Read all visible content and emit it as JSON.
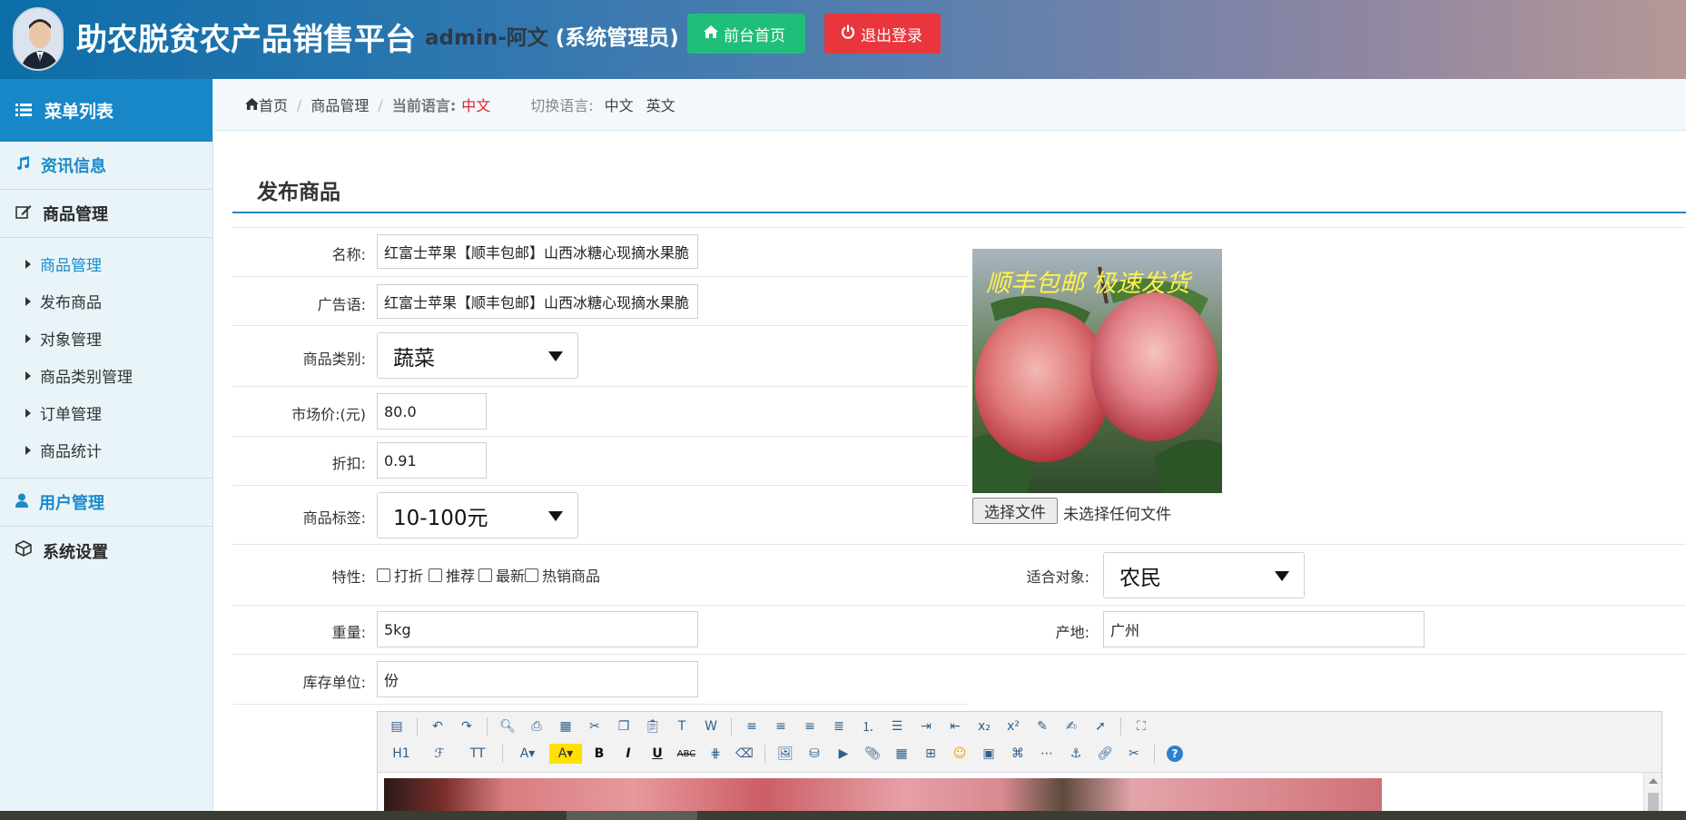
{
  "header": {
    "site_title": "助农脱贫农产品销售平台",
    "admin_user": "admin-阿文",
    "admin_role": "(系统管理员)",
    "home_button": "前台首页",
    "logout_button": "退出登录"
  },
  "sidebar": {
    "menu_title": "菜单列表",
    "sections": {
      "news": "资讯信息",
      "goods": "商品管理",
      "users": "用户管理",
      "settings": "系统设置"
    },
    "sub_items": [
      "商品管理",
      "发布商品",
      "对象管理",
      "商品类别管理",
      "订单管理",
      "商品统计"
    ]
  },
  "breadcrumb": {
    "home": "首页",
    "section": "商品管理",
    "current_lang_label": "当前语言:",
    "current_lang": "中文",
    "switch_label": "切换语言:",
    "lang_zh": "中文",
    "lang_en": "英文"
  },
  "page": {
    "heading": "发布商品"
  },
  "form": {
    "name_label": "名称:",
    "name_value": "红富士苹果【顺丰包邮】山西冰糖心现摘水果脆",
    "slogan_label": "广告语:",
    "slogan_value": "红富士苹果【顺丰包邮】山西冰糖心现摘水果脆",
    "category_label": "商品类别:",
    "category_value": "蔬菜",
    "market_price_label": "市场价:(元)",
    "market_price_value": "80.0",
    "discount_label": "折扣:",
    "discount_value": "0.91",
    "tag_label": "商品标签:",
    "tag_value": "10-100元",
    "features_label": "特性:",
    "features": [
      "打折",
      "推荐",
      "最新",
      "热销商品"
    ],
    "target_label": "适合对象:",
    "target_value": "农民",
    "weight_label": "重量:",
    "weight_value": "5kg",
    "origin_label": "产地:",
    "origin_value": "广州",
    "unit_label": "库存单位:",
    "unit_value": "份"
  },
  "image_upload": {
    "banner_text": "顺丰包邮  极速发货",
    "choose_button": "选择文件",
    "status": "未选择任何文件"
  },
  "editor": {
    "heading_btn": "H1",
    "font_btn": "ℱ",
    "size_btn": "TT",
    "bold": "B",
    "italic": "I",
    "underline": "U",
    "strike": "ABC",
    "subscript": "x₂",
    "superscript": "x²",
    "help": "?"
  },
  "colors": {
    "header_start": "#0c6ea8",
    "sidebar_active": "#1787c7",
    "accent_blue": "#1b8ac9",
    "home_green": "#1fbf7a",
    "logout_red": "#e8363c",
    "lang_red": "#d9282f"
  }
}
